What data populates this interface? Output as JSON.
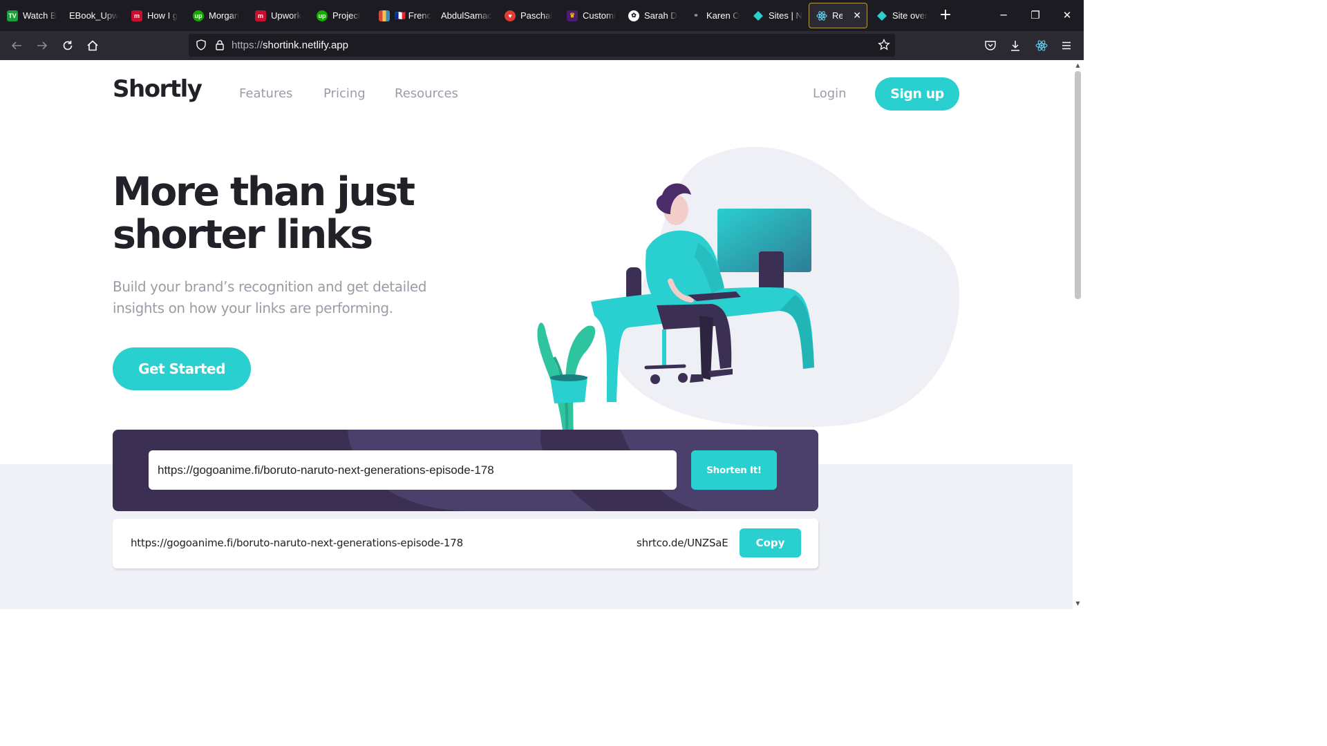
{
  "browser": {
    "tabs": [
      {
        "label": "Watch B",
        "icon": "tv-icon",
        "color": "#1e9e3a"
      },
      {
        "label": "EBook_Upw",
        "icon": "none"
      },
      {
        "label": "How I g",
        "icon": "m-logo-icon",
        "color": "#c8102e"
      },
      {
        "label": "Morgan",
        "icon": "upwork-icon",
        "color": "#14a800"
      },
      {
        "label": "Upwork",
        "icon": "m-logo-icon",
        "color": "#c8102e"
      },
      {
        "label": "Project",
        "icon": "upwork-icon",
        "color": "#14a800"
      },
      {
        "label": "🇫🇷 Frenc",
        "icon": "grid-icon"
      },
      {
        "label": "AbdulSamac",
        "icon": "none"
      },
      {
        "label": "Paschal",
        "icon": "heart-icon",
        "color": "#e03c31"
      },
      {
        "label": "Customi",
        "icon": "crown-icon",
        "color": "#f5b400"
      },
      {
        "label": "Sarah D",
        "icon": "openai-icon",
        "color": "#ffffff"
      },
      {
        "label": "Karen O",
        "icon": "link-icon",
        "color": "#9a9aa6"
      },
      {
        "label": "Sites | N",
        "icon": "netlify-icon",
        "color": "#2acfcf"
      },
      {
        "label": "React",
        "icon": "react-icon",
        "color": "#61dafb",
        "active": true
      },
      {
        "label": "Site over",
        "icon": "netlify-icon",
        "color": "#2acfcf"
      }
    ],
    "url_scheme": "https://",
    "url_host": "shortink.netlify.app"
  },
  "site": {
    "logo": "Shortly",
    "nav": {
      "features": "Features",
      "pricing": "Pricing",
      "resources": "Resources",
      "login": "Login",
      "signup": "Sign up"
    },
    "hero": {
      "title": "More than just shorter links",
      "subtitle": "Build your brand’s recognition and get detailed insights on how your links are performing.",
      "cta": "Get Started"
    },
    "shorten": {
      "input_value": "https://gogoanime.fi/boruto-naruto-next-generations-episode-178",
      "button": "Shorten It!"
    },
    "result": {
      "original": "https://gogoanime.fi/boruto-naruto-next-generations-episode-178",
      "short": "shrtco.de/UNZSaE",
      "copy": "Copy"
    }
  },
  "colors": {
    "cyan": "#2acfcf",
    "dark_violet": "#3b3054",
    "gray_text": "#9e9aa8",
    "very_dark": "#232127"
  }
}
